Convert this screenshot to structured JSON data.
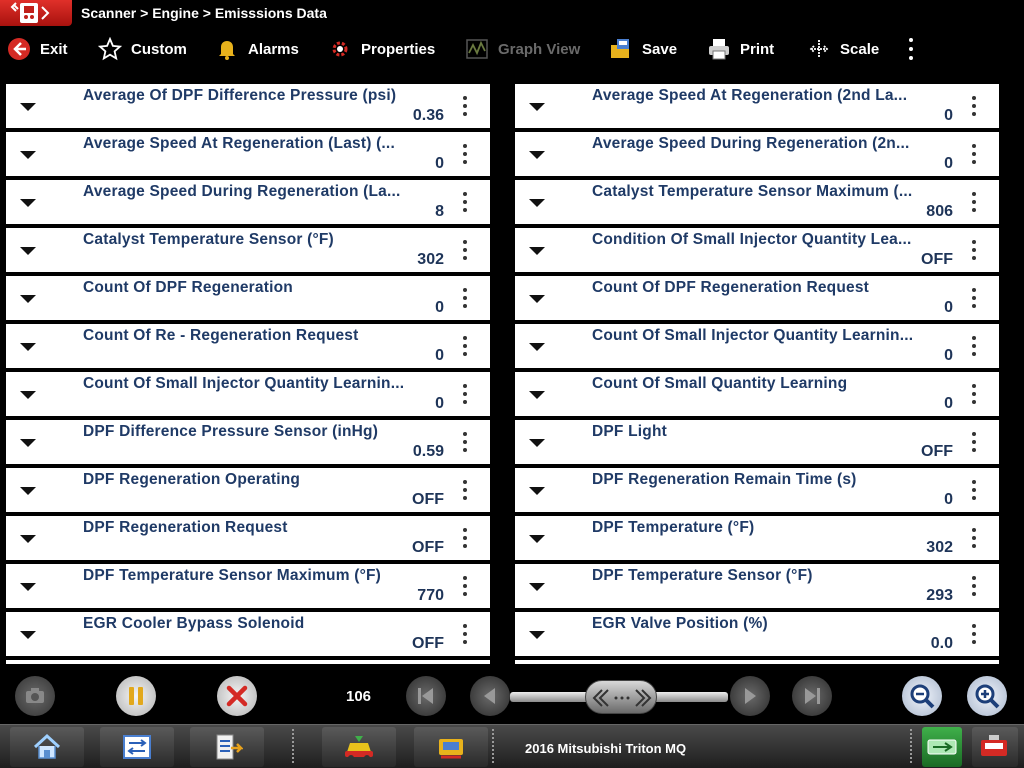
{
  "title_bar": {
    "breadcrumb": "Scanner > Engine > Emisssions Data"
  },
  "toolbar": {
    "exit": "Exit",
    "custom": "Custom",
    "alarms": "Alarms",
    "properties": "Properties",
    "graph_view": "Graph View",
    "save": "Save",
    "print": "Print",
    "scale": "Scale"
  },
  "pids": {
    "left": [
      {
        "name": "Average Of DPF Difference Pressure (psi)",
        "value": "0.36"
      },
      {
        "name": "Average Speed At Regeneration (Last) (...",
        "value": "0"
      },
      {
        "name": "Average Speed During Regeneration (La...",
        "value": "8"
      },
      {
        "name": "Catalyst Temperature Sensor (°F)",
        "value": "302"
      },
      {
        "name": "Count Of DPF Regeneration",
        "value": "0"
      },
      {
        "name": "Count Of Re - Regeneration Request",
        "value": "0"
      },
      {
        "name": "Count Of Small Injector Quantity Learnin...",
        "value": "0"
      },
      {
        "name": "DPF Difference Pressure Sensor (inHg)",
        "value": "0.59"
      },
      {
        "name": "DPF Regeneration Operating",
        "value": "OFF"
      },
      {
        "name": "DPF Regeneration Request",
        "value": "OFF"
      },
      {
        "name": "DPF Temperature Sensor Maximum (°F)",
        "value": "770"
      },
      {
        "name": "EGR Cooler Bypass Solenoid",
        "value": "OFF"
      }
    ],
    "right": [
      {
        "name": "Average Speed At Regeneration (2nd La...",
        "value": "0"
      },
      {
        "name": "Average Speed During Regeneration (2n...",
        "value": "0"
      },
      {
        "name": "Catalyst Temperature Sensor Maximum (...",
        "value": "806"
      },
      {
        "name": "Condition Of Small Injector Quantity Lea...",
        "value": "OFF"
      },
      {
        "name": "Count Of DPF Regeneration Request",
        "value": "0"
      },
      {
        "name": "Count Of Small Injector Quantity Learnin...",
        "value": "0"
      },
      {
        "name": "Count Of Small Quantity Learning",
        "value": "0"
      },
      {
        "name": "DPF Light",
        "value": "OFF"
      },
      {
        "name": "DPF Regeneration Remain Time (s)",
        "value": "0"
      },
      {
        "name": "DPF Temperature (°F)",
        "value": "302"
      },
      {
        "name": "DPF Temperature Sensor (°F)",
        "value": "293"
      },
      {
        "name": "EGR Valve Position (%)",
        "value": "0.0"
      }
    ]
  },
  "controls": {
    "frame_count": "106"
  },
  "taskbar": {
    "vehicle": "2016 Mitsubishi Triton MQ"
  },
  "colors": {
    "accent_red": "#d42a24",
    "pid_name": "#1f3a66",
    "row_bg": "#ffffff",
    "background": "#000000"
  }
}
